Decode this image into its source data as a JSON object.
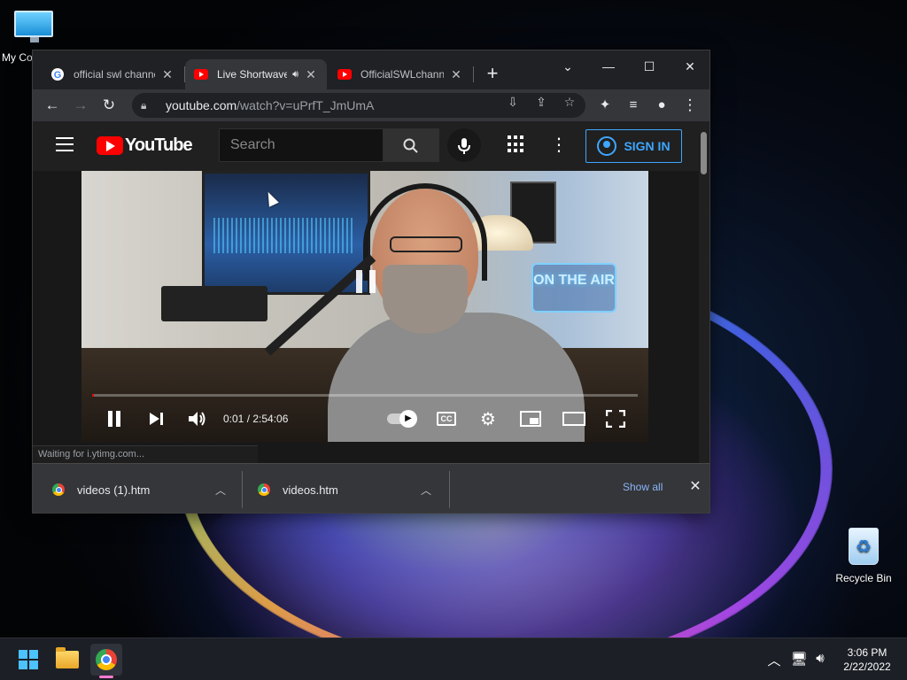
{
  "desktop": {
    "icons": [
      {
        "label": "My Co",
        "icon": "monitor-icon"
      },
      {
        "label": "Recycle Bin",
        "icon": "recycle-bin-icon"
      }
    ]
  },
  "browser": {
    "tabs": [
      {
        "title": "official swl channe",
        "favicon": "google-icon",
        "active": false
      },
      {
        "title": "Live Shortwave",
        "favicon": "youtube-icon",
        "active": true,
        "audio": true
      },
      {
        "title": "OfficialSWLchanne",
        "favicon": "youtube-icon",
        "active": false
      }
    ],
    "new_tab_label": "+",
    "window_controls": {
      "dropdown": "⌄",
      "minimize": "—",
      "maximize": "☐",
      "close": "✕"
    },
    "address": {
      "host": "youtube.com",
      "path": "/watch?v=uPrfT_JmUmA"
    },
    "status_text": "Waiting for i.ytimg.com..."
  },
  "youtube": {
    "logo_text": "YouTube",
    "search_placeholder": "Search",
    "sign_in_label": "SIGN IN",
    "player": {
      "current_time": "0:01",
      "duration": "2:54:06",
      "time_display": "0:01 / 2:54:06",
      "progress_fraction": 0.0001,
      "sign_text": "ON THE AIR",
      "cc_label": "CC"
    }
  },
  "downloads": {
    "items": [
      {
        "name": "videos (1).htm"
      },
      {
        "name": "videos.htm"
      }
    ],
    "show_all_label": "Show all"
  },
  "taskbar": {
    "time": "3:06 PM",
    "date": "2/22/2022"
  },
  "colors": {
    "youtube_red": "#ff0000",
    "signin_blue": "#3ea6ff",
    "chrome_dark": "#202124",
    "link_blue": "#8ab4f8"
  }
}
